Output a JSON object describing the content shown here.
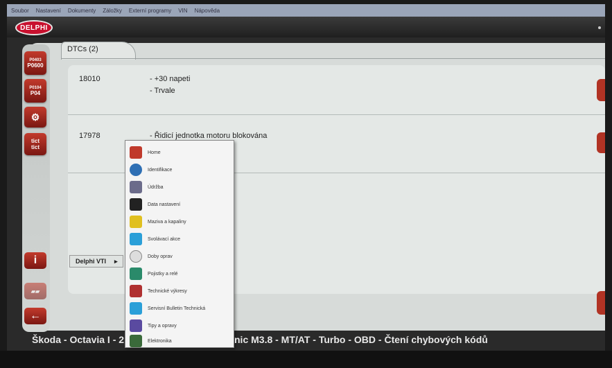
{
  "menubar": {
    "items": [
      "Soubor",
      "Nastavení",
      "Dokumenty",
      "Záložky",
      "Externí programy",
      "VIN",
      "Nápověda"
    ]
  },
  "header": {
    "logo": "DELPHI"
  },
  "sidebar": {
    "btn1_line1": "P0403",
    "btn1_line2": "P0600",
    "btn2_line1": "P0104",
    "btn2_line2": "P04",
    "btn4_line1": "tict",
    "btn4_line2": "tict",
    "info_label": "i",
    "back_label": "←"
  },
  "tab": {
    "label": "DTCs (2)"
  },
  "dtcs": [
    {
      "code": "18010",
      "line1": "- +30 napeti",
      "line2": "- Trvale"
    },
    {
      "code": "17978",
      "line1": "- Řidicí jednotka motoru blokována",
      "line2": ""
    }
  ],
  "popup": {
    "delphi_vti": "Delphi VTI",
    "arrow": "▸",
    "items": [
      {
        "label": "Home",
        "icon": "home-icon",
        "color": "#c0392b"
      },
      {
        "label": "Identifikace",
        "icon": "car-icon",
        "color": "#2e6fb4"
      },
      {
        "label": "Údržba",
        "icon": "maintenance-icon",
        "color": "#6b6b8a"
      },
      {
        "label": "Data nastavení",
        "icon": "gauge-icon",
        "color": "#222222"
      },
      {
        "label": "Maziva a kapaliny",
        "icon": "oil-icon",
        "color": "#e0c020"
      },
      {
        "label": "Svolávací akce",
        "icon": "recall-icon",
        "color": "#2a9fd8"
      },
      {
        "label": "Doby oprav",
        "icon": "clock-icon",
        "color": "#dddddd"
      },
      {
        "label": "Pojistky a relé",
        "icon": "fuse-icon",
        "color": "#2a8a6a"
      },
      {
        "label": "Technické výkresy",
        "icon": "drawing-icon",
        "color": "#b03030"
      },
      {
        "label": "Servisní Bulletin Technická",
        "icon": "bulletin-icon",
        "color": "#2a9fd8"
      },
      {
        "label": "Tipy a opravy",
        "icon": "tips-icon",
        "color": "#5a4aa0"
      },
      {
        "label": "Elektronika",
        "icon": "electronics-icon",
        "color": "#3a6a3a"
      }
    ]
  },
  "status": {
    "left": "Škoda - Octavia I - 2",
    "right": "nic M3.8 - MT/AT - Turbo - OBD - Čtení chybových kódů"
  },
  "colors": {
    "accent_red": "#c23a2c",
    "panel": "#d7dbd9"
  }
}
